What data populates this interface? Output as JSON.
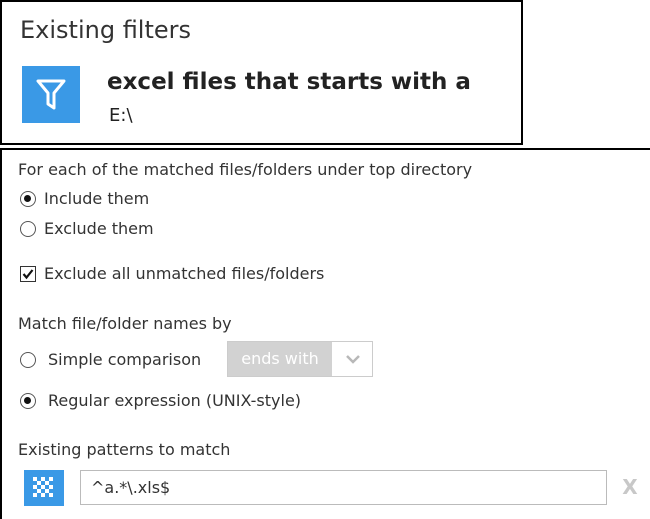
{
  "filters": {
    "heading": "Existing filters",
    "item": {
      "name": "excel files that starts with a",
      "path": "E:\\",
      "icon": "filter-icon"
    }
  },
  "options": {
    "matched_heading": "For each of the matched files/folders under top directory",
    "include_label": "Include them",
    "include_checked": true,
    "exclude_label": "Exclude them",
    "exclude_checked": false,
    "exclude_unmatched_label": "Exclude all unmatched files/folders",
    "exclude_unmatched_checked": true,
    "match_by_heading": "Match file/folder names by",
    "simple_label": "Simple comparison",
    "simple_checked": false,
    "simple_dropdown_value": "ends with",
    "regex_label": "Regular expression (UNIX-style)",
    "regex_checked": true,
    "patterns_heading": "Existing patterns to match",
    "pattern_value": "^a.*\\.xls$",
    "remove_label": "X"
  },
  "colors": {
    "accent": "#3a99e6",
    "disabled_dropdown": "#d2d2d2"
  }
}
